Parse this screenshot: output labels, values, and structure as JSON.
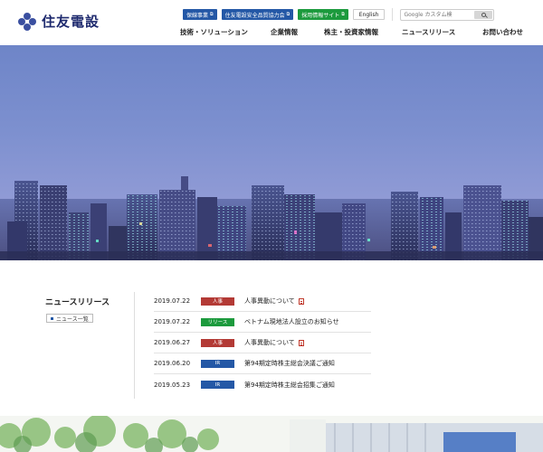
{
  "brand": {
    "name": "住友電設",
    "icon": "logo-icon"
  },
  "top_links": [
    {
      "label": "保線事業",
      "color": "#2458a6"
    },
    {
      "label": "住友電設安全品質協力会",
      "color": "#2458a6"
    },
    {
      "label": "採用情報サイト",
      "color": "#1c9a3d"
    }
  ],
  "english_label": "English",
  "search": {
    "placeholder": "Google カスタム検",
    "icon": "search-icon"
  },
  "nav": [
    {
      "label": "技術・ソリューション"
    },
    {
      "label": "企業情報"
    },
    {
      "label": "株主・投資家情報"
    },
    {
      "label": "ニュースリリース"
    },
    {
      "label": "お問い合わせ"
    }
  ],
  "news": {
    "title": "ニュースリリース",
    "all_label": "ニュース一覧",
    "items": [
      {
        "date": "2019.07.22",
        "category": "人事",
        "text": "人事異動について",
        "pdf": true
      },
      {
        "date": "2019.07.22",
        "category": "リリース",
        "text": "ベトナム現地法人設立のお知らせ",
        "pdf": false
      },
      {
        "date": "2019.06.27",
        "category": "人事",
        "text": "人事異動について",
        "pdf": true
      },
      {
        "date": "2019.06.20",
        "category": "IR",
        "text": "第94期定時株主総会決議ご通知",
        "pdf": false
      },
      {
        "date": "2019.05.23",
        "category": "IR",
        "text": "第94期定時株主総会招集ご通知",
        "pdf": false
      }
    ]
  },
  "colors": {
    "accent_blue": "#2458a6",
    "accent_green": "#1c9a3d",
    "accent_red": "#b33a35",
    "brand_navy": "#1e2a6e"
  }
}
